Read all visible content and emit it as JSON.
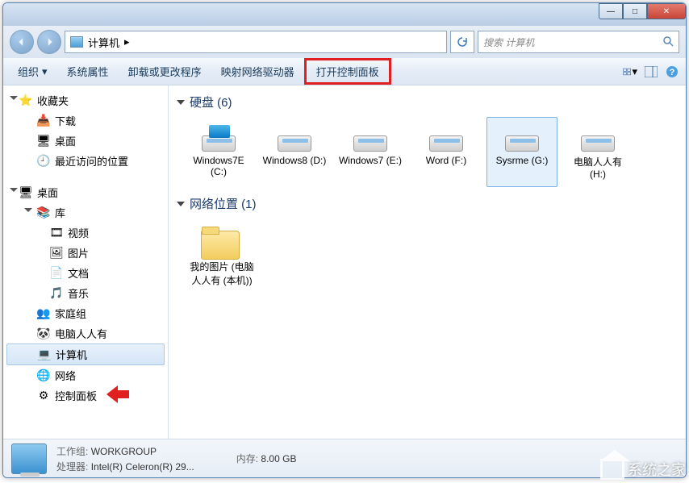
{
  "titlebar": {
    "min": "—",
    "max": "□",
    "close": "✕"
  },
  "nav": {
    "path_icon": "computer-icon",
    "path_text": "计算机",
    "path_arrow": "▸",
    "search_placeholder": "搜索 计算机"
  },
  "toolbar": {
    "org": "组织",
    "props": "系统属性",
    "uninstall": "卸载或更改程序",
    "mapdrive": "映射网络驱动器",
    "ctrlpanel": "打开控制面板"
  },
  "sidebar": {
    "fav": "收藏夹",
    "downloads": "下载",
    "desktop": "桌面",
    "recent": "最近访问的位置",
    "desktop2": "桌面",
    "lib": "库",
    "videos": "视频",
    "pictures": "图片",
    "docs": "文档",
    "music": "音乐",
    "homegroup": "家庭组",
    "user": "电脑人人有",
    "computer": "计算机",
    "network": "网络",
    "ctrlpanel": "控制面板"
  },
  "content": {
    "section_hdd": "硬盘 (6)",
    "drives": [
      {
        "name": "Windows7E (C:)"
      },
      {
        "name": "Windows8 (D:)"
      },
      {
        "name": "Windows7 (E:)"
      },
      {
        "name": "Word (F:)"
      },
      {
        "name": "Sysrme (G:)"
      },
      {
        "name": "电脑人人有 (H:)"
      }
    ],
    "section_net": "网络位置 (1)",
    "netitems": [
      {
        "name": "我的图片 (电脑人人有 (本机))"
      }
    ]
  },
  "status": {
    "workgroup_label": "工作组:",
    "workgroup": "WORKGROUP",
    "cpu_label": "处理器:",
    "cpu": "Intel(R) Celeron(R) 29...",
    "mem_label": "内存:",
    "mem": "8.00 GB"
  },
  "watermark": "系统之家"
}
